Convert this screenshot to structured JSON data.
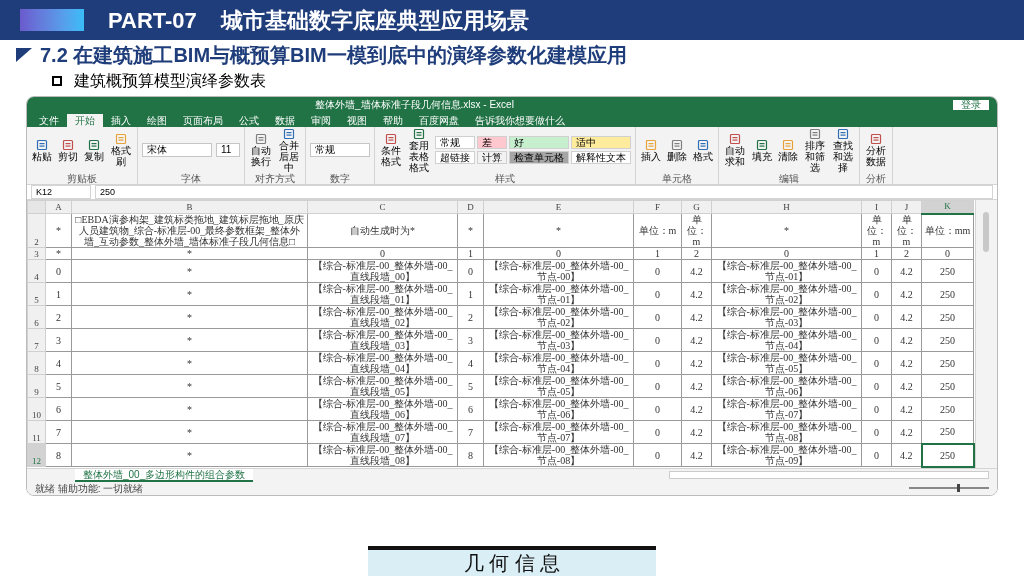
{
  "slide": {
    "part_label": "PART-07",
    "title": "城市基础数字底座典型应用场景",
    "heading_number": "7.2",
    "heading": "在建筑施工BIM与概预算BIM一模到底中的演绎参数化建模应用",
    "bullet": "建筑概预算模型演绎参数表"
  },
  "excel": {
    "title": "整体外墙_墙体标准子段几何信息.xlsx - Excel",
    "login": "登录",
    "tabs": [
      {
        "label": "文件",
        "selected": false
      },
      {
        "label": "开始",
        "selected": true
      },
      {
        "label": "插入",
        "selected": false
      },
      {
        "label": "绘图",
        "selected": false
      },
      {
        "label": "页面布局",
        "selected": false
      },
      {
        "label": "公式",
        "selected": false
      },
      {
        "label": "数据",
        "selected": false
      },
      {
        "label": "审阅",
        "selected": false
      },
      {
        "label": "视图",
        "selected": false
      },
      {
        "label": "帮助",
        "selected": false
      },
      {
        "label": "百度网盘",
        "selected": false
      }
    ],
    "tell_me": "告诉我你想要做什么",
    "groups": [
      {
        "label": "剪贴板",
        "buttons": [
          "粘贴",
          "剪切",
          "复制",
          "格式刷"
        ]
      },
      {
        "label": "字体",
        "font": "宋体",
        "size": "11"
      },
      {
        "label": "对齐方式",
        "buttons": [
          "自动换行",
          "合并后居中"
        ]
      },
      {
        "label": "数字",
        "number_format": "常规"
      },
      {
        "label": "样式",
        "buttons": [
          "条件格式",
          "套用表格格式"
        ],
        "styles": [
          {
            "label": "常规",
            "color": "#ffffff"
          },
          {
            "label": "差",
            "color": "#ffc7ce"
          },
          {
            "label": "好",
            "color": "#c6efce"
          },
          {
            "label": "适中",
            "color": "#ffeb9c"
          },
          {
            "label": "超链接",
            "color": "#ffffff"
          },
          {
            "label": "计算",
            "color": "#f2f2f2"
          },
          {
            "label": "检查单元格",
            "color": "#a5a5a5"
          },
          {
            "label": "解释性文本",
            "color": "#ffffff"
          }
        ]
      },
      {
        "label": "单元格",
        "buttons": [
          "插入",
          "删除",
          "格式"
        ]
      },
      {
        "label": "编辑",
        "buttons": [
          "自动求和",
          "填充",
          "清除",
          "排序和筛选",
          "查找和选择"
        ]
      },
      {
        "label": "分析",
        "buttons": [
          "分析数据"
        ]
      }
    ],
    "name_box": "K12",
    "formula": "250",
    "columns": [
      {
        "label": "A",
        "selected": false
      },
      {
        "label": "B",
        "selected": false
      },
      {
        "label": "C",
        "selected": false
      },
      {
        "label": "D",
        "selected": false
      },
      {
        "label": "E",
        "selected": false
      },
      {
        "label": "F",
        "selected": false
      },
      {
        "label": "G",
        "selected": false
      },
      {
        "label": "H",
        "selected": false
      },
      {
        "label": "I",
        "selected": false
      },
      {
        "label": "J",
        "selected": false
      },
      {
        "label": "K",
        "selected": true
      }
    ],
    "rows": [
      {
        "label": "2",
        "selected": false,
        "cells": [
          "*",
          "□EBDA演参构架_建筑标类拖地_建筑标层拖地_原庆人员建筑物_综合-标准层-00_最终参数框架_整体外墙_互动参数_整体外墙_墙体标准子段几何信息□",
          "自动生成时为*",
          "*",
          "*",
          "单位：m",
          "单位：m",
          "*",
          "单位：m",
          "单位：m",
          "单位：mm"
        ]
      },
      {
        "label": "3",
        "selected": false,
        "cells": [
          "*",
          "*",
          "0",
          "1",
          "0",
          "1",
          "2",
          "0",
          "1",
          "2",
          "0"
        ]
      },
      {
        "label": "4",
        "selected": false,
        "cells": [
          "0",
          "*",
          "【综合-标准层-00_整体外墙-00_直线段墙_00】",
          "0",
          "【综合-标准层-00_整体外墙-00_节点-00】",
          "0",
          "4.2",
          "【综合-标准层-00_整体外墙-00_节点-01】",
          "0",
          "4.2",
          "250"
        ]
      },
      {
        "label": "5",
        "selected": false,
        "cells": [
          "1",
          "*",
          "【综合-标准层-00_整体外墙-00_直线段墙_01】",
          "1",
          "【综合-标准层-00_整体外墙-00_节点-01】",
          "0",
          "4.2",
          "【综合-标准层-00_整体外墙-00_节点-02】",
          "0",
          "4.2",
          "250"
        ]
      },
      {
        "label": "6",
        "selected": false,
        "cells": [
          "2",
          "*",
          "【综合-标准层-00_整体外墙-00_直线段墙_02】",
          "2",
          "【综合-标准层-00_整体外墙-00_节点-02】",
          "0",
          "4.2",
          "【综合-标准层-00_整体外墙-00_节点-03】",
          "0",
          "4.2",
          "250"
        ]
      },
      {
        "label": "7",
        "selected": false,
        "cells": [
          "3",
          "*",
          "【综合-标准层-00_整体外墙-00_直线段墙_03】",
          "3",
          "【综合-标准层-00_整体外墙-00_节点-03】",
          "0",
          "4.2",
          "【综合-标准层-00_整体外墙-00_节点-04】",
          "0",
          "4.2",
          "250"
        ]
      },
      {
        "label": "8",
        "selected": false,
        "cells": [
          "4",
          "*",
          "【综合-标准层-00_整体外墙-00_直线段墙_04】",
          "4",
          "【综合-标准层-00_整体外墙-00_节点-04】",
          "0",
          "4.2",
          "【综合-标准层-00_整体外墙-00_节点-05】",
          "0",
          "4.2",
          "250"
        ]
      },
      {
        "label": "9",
        "selected": false,
        "cells": [
          "5",
          "*",
          "【综合-标准层-00_整体外墙-00_直线段墙_05】",
          "5",
          "【综合-标准层-00_整体外墙-00_节点-05】",
          "0",
          "4.2",
          "【综合-标准层-00_整体外墙-00_节点-06】",
          "0",
          "4.2",
          "250"
        ]
      },
      {
        "label": "10",
        "selected": false,
        "cells": [
          "6",
          "*",
          "【综合-标准层-00_整体外墙-00_直线段墙_06】",
          "6",
          "【综合-标准层-00_整体外墙-00_节点-06】",
          "0",
          "4.2",
          "【综合-标准层-00_整体外墙-00_节点-07】",
          "0",
          "4.2",
          "250"
        ]
      },
      {
        "label": "11",
        "selected": false,
        "cells": [
          "7",
          "*",
          "【综合-标准层-00_整体外墙-00_直线段墙_07】",
          "7",
          "【综合-标准层-00_整体外墙-00_节点-07】",
          "0",
          "4.2",
          "【综合-标准层-00_整体外墙-00_节点-08】",
          "0",
          "4.2",
          "250"
        ]
      },
      {
        "label": "12",
        "selected": true,
        "cells": [
          "8",
          "*",
          "【综合-标准层-00_整体外墙-00_直线段墙_08】",
          "8",
          "【综合-标准层-00_整体外墙-00_节点-08】",
          "0",
          "4.2",
          "【综合-标准层-00_整体外墙-00_节点-09】",
          "0",
          "4.2",
          "250"
        ]
      }
    ],
    "sheet_tabs": [
      {
        "label": "整体外墙_00_多边形构件的组合参数",
        "selected": true
      }
    ],
    "status": "就绪 辅助功能: 一切就绪",
    "zoom": {
      "level": 0.6
    }
  },
  "banner": "几 何 信 息"
}
